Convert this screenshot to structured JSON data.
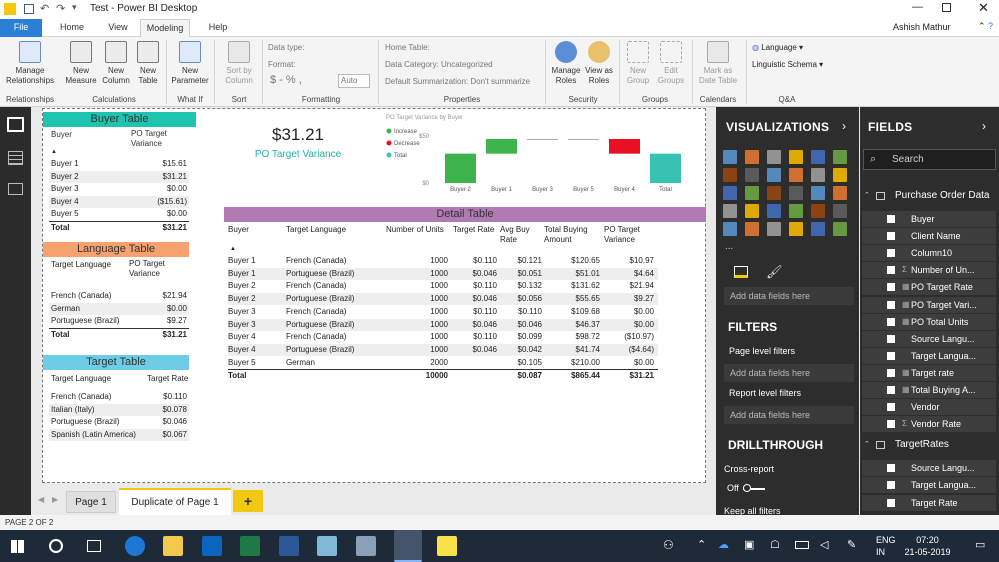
{
  "window": {
    "title": "Test - Power BI Desktop",
    "user": "Ashish Mathur"
  },
  "menu_tabs": [
    "File",
    "Home",
    "View",
    "Modeling",
    "Help"
  ],
  "ribbon": {
    "buttons": [
      "Manage Relationships",
      "New Measure",
      "New Column",
      "New Table",
      "New Parameter",
      "Sort by Column",
      "Manage Roles",
      "View as Roles",
      "New Group",
      "Edit Groups",
      "Mark as Date Table"
    ],
    "groups": [
      "Relationships",
      "Calculations",
      "What If",
      "Sort",
      "Formatting",
      "Properties",
      "Security",
      "Groups",
      "Calendars",
      "Q&A"
    ],
    "data_type": "Data type:",
    "format": "Format:",
    "auto": "Auto",
    "home_table": "Home Table:",
    "data_category": "Data Category: Uncategorized",
    "default_summarization": "Default Summarization: Don't summarize",
    "language": "Language",
    "linguistic_schema": "Linguistic Schema",
    "currency_symbols": "$ - % ,"
  },
  "card": {
    "value": "$31.21",
    "label": "PO Target Variance"
  },
  "chart_data": {
    "type": "waterfall",
    "title": "PO Target Variance by Buyer",
    "categories": [
      "Buyer 2",
      "Buyer 1",
      "Buyer 3",
      "Buyer 5",
      "Buyer 4",
      "Total"
    ],
    "values": [
      31.21,
      15.61,
      0.0,
      0.0,
      -15.61,
      31.21
    ],
    "legend": [
      "Increase",
      "Decrease",
      "Total"
    ],
    "colors": {
      "increase": "#3cb44b",
      "decrease": "#e81123",
      "total": "#37c2b4"
    },
    "y_ticks": [
      "$50",
      "$0"
    ],
    "ylim": [
      0,
      50
    ]
  },
  "buyer_table": {
    "title": "Buyer Table",
    "headers": [
      "Buyer",
      "PO Target Variance"
    ],
    "rows": [
      [
        "Buyer 1",
        "$15.61"
      ],
      [
        "Buyer 2",
        "$31.21"
      ],
      [
        "Buyer 3",
        "$0.00"
      ],
      [
        "Buyer 4",
        "($15.61)"
      ],
      [
        "Buyer 5",
        "$0.00"
      ]
    ],
    "total": [
      "Total",
      "$31.21"
    ]
  },
  "language_table": {
    "title": "Language Table",
    "headers": [
      "Target Language",
      "PO Target Variance"
    ],
    "rows": [
      [
        "French (Canada)",
        "$21.94"
      ],
      [
        "German",
        "$0.00"
      ],
      [
        "Portuguese (Brazil)",
        "$9.27"
      ]
    ],
    "total": [
      "Total",
      "$31.21"
    ]
  },
  "target_table": {
    "title": "Target Table",
    "headers": [
      "Target Language",
      "Target Rate"
    ],
    "rows": [
      [
        "French (Canada)",
        "$0.110"
      ],
      [
        "Italian (Italy)",
        "$0.078"
      ],
      [
        "Portuguese (Brazil)",
        "$0.046"
      ],
      [
        "Spanish (Latin America)",
        "$0.067"
      ]
    ]
  },
  "detail_table": {
    "title": "Detail Table",
    "headers": [
      "Buyer",
      "Target Language",
      "Number of Units",
      "Target Rate",
      "Avg Buy Rate",
      "Total Buying Amount",
      "PO Target Variance"
    ],
    "rows": [
      [
        "Buyer 1",
        "French (Canada)",
        "1000",
        "$0.110",
        "$0.121",
        "$120.65",
        "$10.97"
      ],
      [
        "Buyer 1",
        "Portuguese (Brazil)",
        "1000",
        "$0.046",
        "$0.051",
        "$51.01",
        "$4.64"
      ],
      [
        "Buyer 2",
        "French (Canada)",
        "1000",
        "$0.110",
        "$0.132",
        "$131.62",
        "$21.94"
      ],
      [
        "Buyer 2",
        "Portuguese (Brazil)",
        "1000",
        "$0.046",
        "$0.056",
        "$55.65",
        "$9.27"
      ],
      [
        "Buyer 3",
        "French (Canada)",
        "1000",
        "$0.110",
        "$0.110",
        "$109.68",
        "$0.00"
      ],
      [
        "Buyer 3",
        "Portuguese (Brazil)",
        "1000",
        "$0.046",
        "$0.046",
        "$46.37",
        "$0.00"
      ],
      [
        "Buyer 4",
        "French (Canada)",
        "1000",
        "$0.110",
        "$0.099",
        "$98.72",
        "($10.97)"
      ],
      [
        "Buyer 4",
        "Portuguese (Brazil)",
        "1000",
        "$0.046",
        "$0.042",
        "$41.74",
        "($4.64)"
      ],
      [
        "Buyer 5",
        "German",
        "2000",
        "",
        "$0.105",
        "$210.00",
        "$0.00"
      ]
    ],
    "total": [
      "Total",
      "",
      "10000",
      "",
      "$0.087",
      "$865.44",
      "$31.21"
    ]
  },
  "pages": {
    "page1": "Page 1",
    "page2": "Duplicate of Page 1",
    "add": "+"
  },
  "status": "PAGE 2 OF 2",
  "viz_pane": {
    "title": "VISUALIZATIONS",
    "add_fields": "Add data fields here",
    "filters": "FILTERS",
    "page_filters": "Page level filters",
    "add_fields2": "Add data fields here",
    "report_filters": "Report level filters",
    "add_fields3": "Add data fields here",
    "drillthrough": "DRILLTHROUGH",
    "cross_report": "Cross-report",
    "off": "Off",
    "keep_filters": "Keep all filters",
    "more": "..."
  },
  "fields_pane": {
    "title": "FIELDS",
    "search_placeholder": "Search",
    "tables": [
      {
        "name": "Purchase Order Data",
        "fields": [
          {
            "label": "Buyer",
            "sigma": ""
          },
          {
            "label": "Client Name",
            "sigma": ""
          },
          {
            "label": "Column10",
            "sigma": ""
          },
          {
            "label": "Number of Un...",
            "sigma": "Σ"
          },
          {
            "label": "PO Target Rate",
            "sigma": "▦"
          },
          {
            "label": "PO Target Vari...",
            "sigma": "▦"
          },
          {
            "label": "PO Total Units",
            "sigma": "▦"
          },
          {
            "label": "Source Langu...",
            "sigma": ""
          },
          {
            "label": "Target Langua...",
            "sigma": ""
          },
          {
            "label": "Target rate",
            "sigma": "▦"
          },
          {
            "label": "Total Buying A...",
            "sigma": "▦"
          },
          {
            "label": "Vendor",
            "sigma": ""
          },
          {
            "label": "Vendor Rate",
            "sigma": "Σ"
          }
        ]
      },
      {
        "name": "TargetRates",
        "fields": [
          {
            "label": "Source Langu...",
            "sigma": ""
          },
          {
            "label": "Target Langua...",
            "sigma": ""
          },
          {
            "label": "Target Rate",
            "sigma": ""
          }
        ]
      }
    ]
  },
  "taskbar": {
    "lang1": "ENG",
    "lang2": "IN",
    "time": "07:20",
    "date": "21-05-2019"
  }
}
